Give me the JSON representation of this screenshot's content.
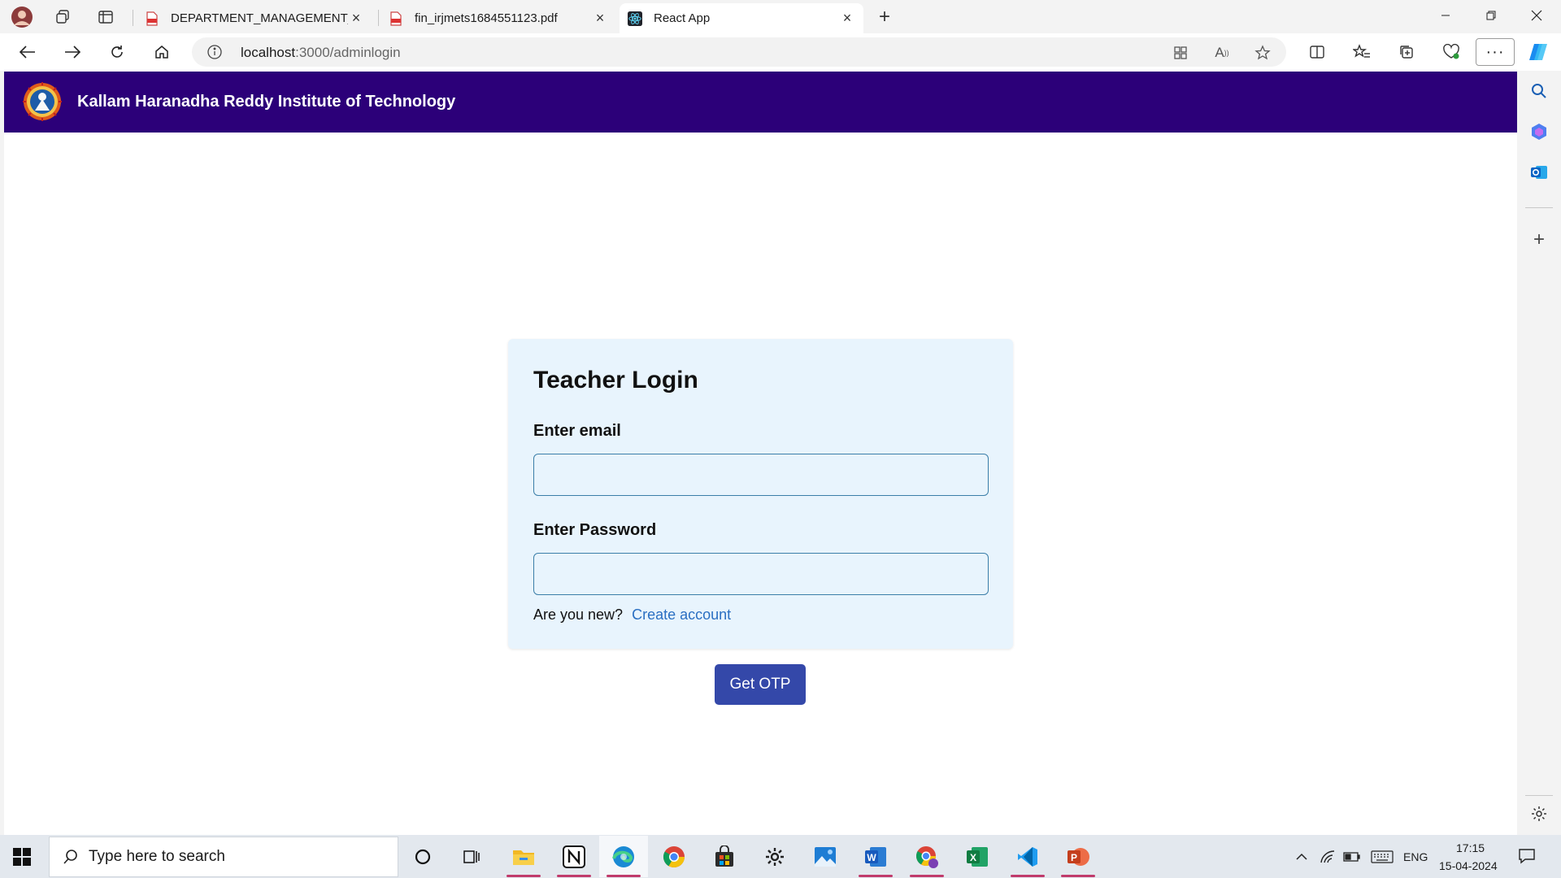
{
  "browser": {
    "tabs": [
      {
        "title": "DEPARTMENT_MANAGEMENT_S",
        "icon": "pdf-icon"
      },
      {
        "title": "fin_irjmets1684551123.pdf",
        "icon": "pdf-icon"
      },
      {
        "title": "React App",
        "icon": "react-icon"
      }
    ],
    "address": {
      "host": "localhost",
      "path": ":3000/adminlogin"
    }
  },
  "site": {
    "title": "Kallam Haranadha Reddy Institute of Technology"
  },
  "login": {
    "heading": "Teacher Login",
    "email_label": "Enter email",
    "email_value": "",
    "password_label": "Enter Password",
    "password_value": "",
    "signup_prompt": "Are you new?",
    "signup_link": "Create account",
    "submit_label": "Get OTP"
  },
  "taskbar": {
    "search_placeholder": "Type here to search",
    "language": "ENG",
    "time": "17:15",
    "date": "15-04-2024",
    "apps": [
      "cortana-icon",
      "task-view-icon",
      "file-explorer-icon",
      "notion-icon",
      "edge-icon",
      "chrome-icon",
      "store-icon",
      "settings-icon",
      "photos-icon",
      "word-icon",
      "chrome-profile-icon",
      "excel-icon",
      "vscode-icon",
      "powerpoint-icon"
    ]
  },
  "colors": {
    "header_bg": "#2c0079",
    "card_bg": "#e8f4fd",
    "button_bg": "#3448a9",
    "link": "#2a6fc2"
  }
}
